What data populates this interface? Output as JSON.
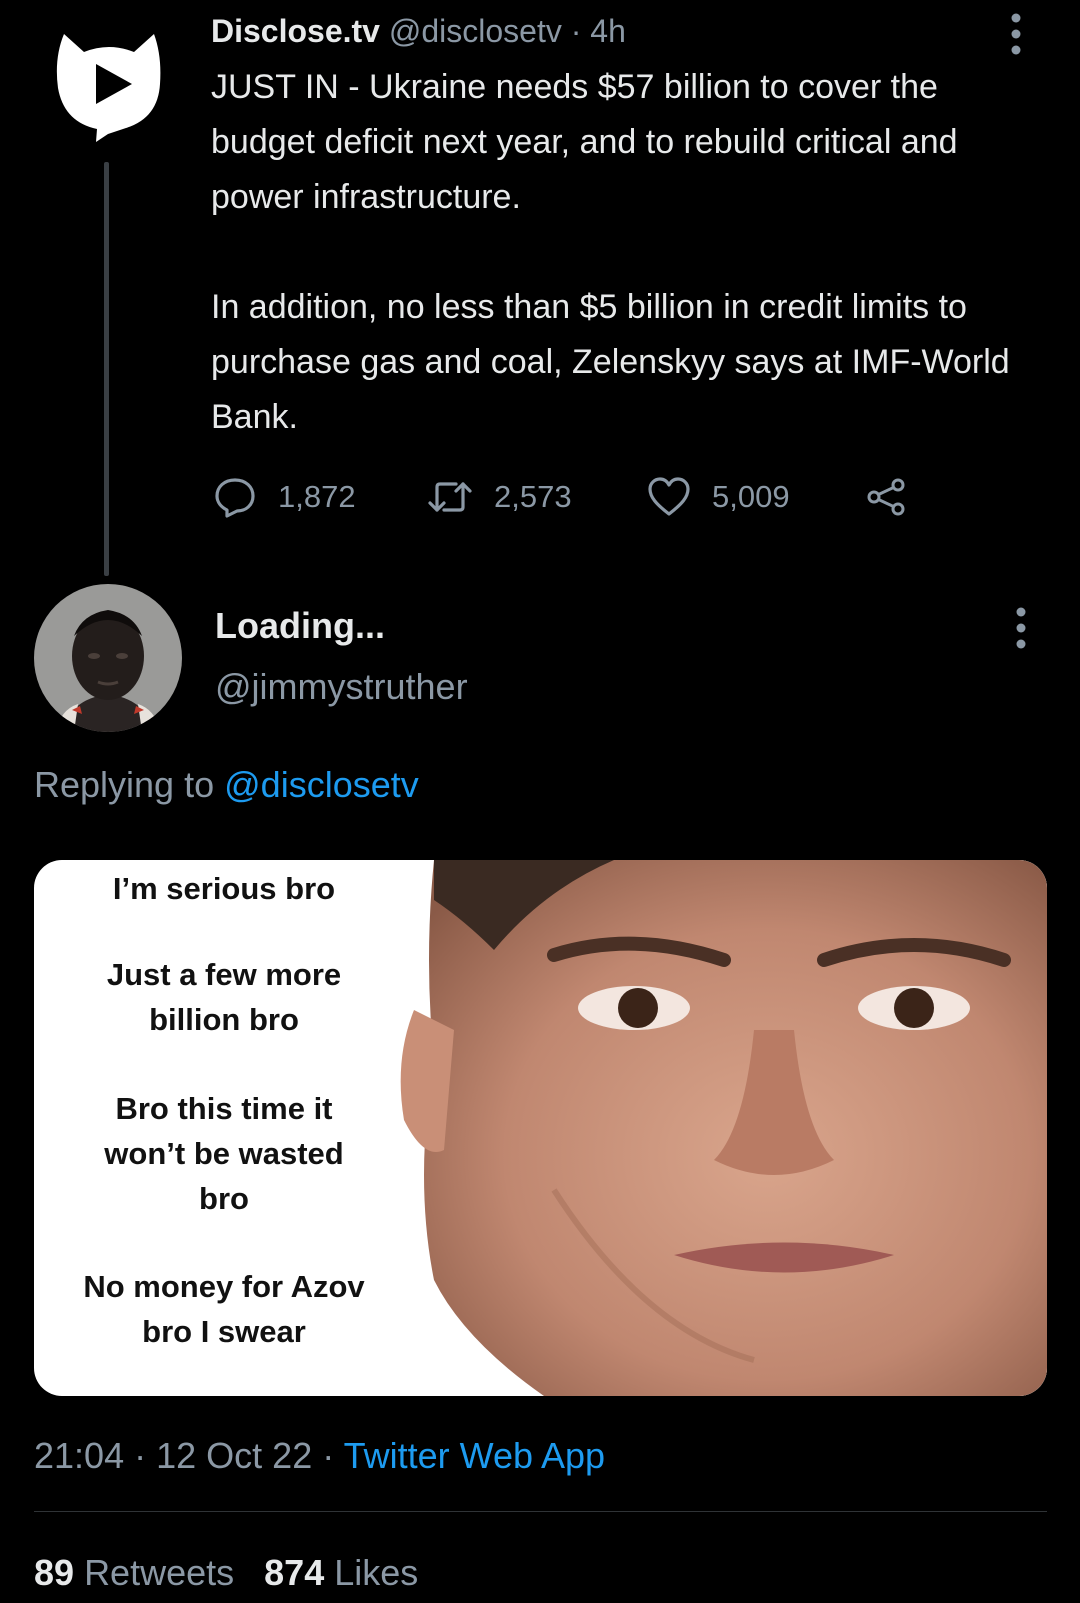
{
  "parent_tweet": {
    "author_name": "Disclose.tv",
    "handle": "@disclosetv",
    "separator": "·",
    "time": "4h",
    "paragraph_1": "JUST IN - Ukraine needs $57 billion to cover the budget deficit next year, and to rebuild critical and power infrastructure.",
    "paragraph_2": "In addition, no less than $5 billion in credit limits to purchase gas and coal, Zelenskyy says at IMF-World Bank.",
    "replies": "1,872",
    "retweets": "2,573",
    "likes": "5,009",
    "avatar_icon": "play-cat-logo-icon"
  },
  "reply_tweet": {
    "author_name": "Loading...",
    "handle": "@jimmystruther",
    "replying_label": "Replying to",
    "replying_mention": "@disclosetv",
    "image_text": {
      "line_1": "I’m serious bro",
      "line_2": "Just a few more",
      "line_3": "billion bro",
      "line_4": "Bro this time it",
      "line_5": "won’t be wasted",
      "line_6": "bro",
      "line_7": "No money for Azov",
      "line_8": "bro I swear"
    },
    "time": "21:04",
    "date": "12 Oct 22",
    "dot": "·",
    "app": "Twitter Web App",
    "retweet_count": "89",
    "retweet_label": "Retweets",
    "like_count": "874",
    "like_label": "Likes"
  },
  "colors": {
    "background": "#000000",
    "text": "#e7e9ea",
    "muted": "#8b98a5",
    "link": "#1d9bf0"
  }
}
